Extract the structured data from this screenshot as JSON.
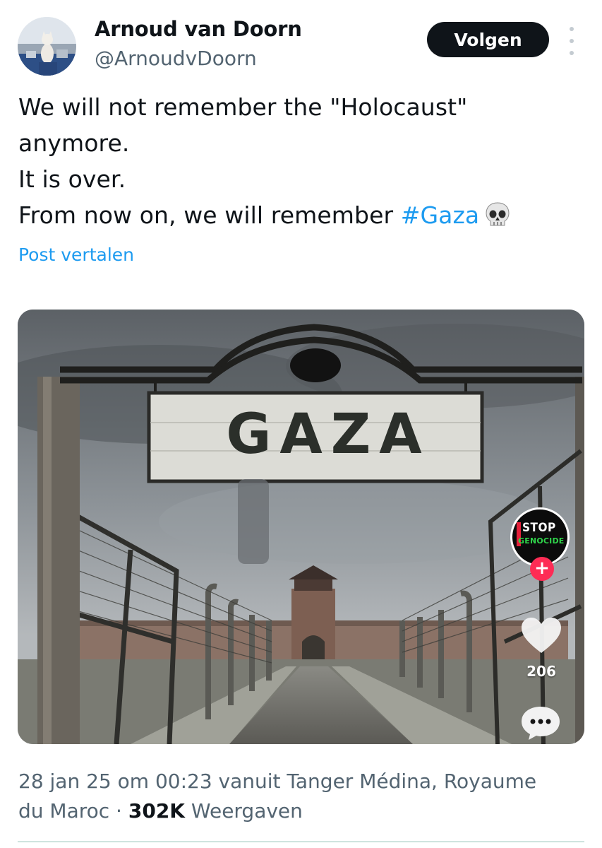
{
  "author": {
    "name": "Arnoud van Doorn",
    "handle": "@ArnoudvDoorn"
  },
  "header": {
    "follow_label": "Volgen",
    "more_icon": "more-vertical-icon"
  },
  "tweet": {
    "lines": [
      "We will not remember the \"Holocaust\"",
      "anymore.",
      "It is over.",
      "From now on, we will remember "
    ],
    "hashtag": "#Gaza",
    "emoji_icon": "skull-icon",
    "translate_label": "Post vertalen"
  },
  "media": {
    "sign_text": "GAZA",
    "overlay": {
      "badge_line1": "STOP",
      "badge_line2": "GENOCIDE",
      "follow_plus": "+",
      "like_count": "206"
    }
  },
  "meta": {
    "line1": "28 jan 25 om 00:23 vanuit Tanger Médina, Royaume",
    "line2_prefix": "du Maroc · ",
    "views": "302K",
    "views_label": " Weergaven"
  },
  "colors": {
    "accent": "#1d9bf0",
    "text_primary": "#0f1419",
    "text_secondary": "#536471",
    "follow_bg": "#0f1419",
    "tiktok_red": "#fe2c55"
  }
}
